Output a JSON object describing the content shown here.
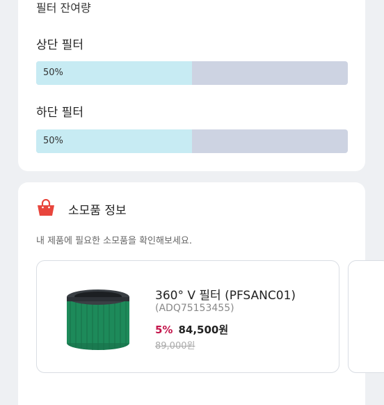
{
  "filter_status": {
    "title": "필터 잔여량",
    "filters": [
      {
        "label": "상단 필터",
        "percent_text": "50%",
        "remaining_fraction": 0.5
      },
      {
        "label": "하단 필터",
        "percent_text": "50%",
        "remaining_fraction": 0.5
      }
    ]
  },
  "consumables": {
    "icon": "shopping-bag-icon",
    "title": "소모품 정보",
    "description": "내 제품에 필요한 소모품을 확인해보세요.",
    "products": [
      {
        "name": "360° V 필터 (PFSANC01)",
        "code": "(ADQ75153455)",
        "discount": "5%",
        "price": "84,500원",
        "original_price": "89,000원"
      }
    ]
  },
  "colors": {
    "bar_fill": "#c7ebf3",
    "bar_track": "#cdd3e2",
    "discount": "#c4154b",
    "bag_icon": "#e8453c",
    "filter_green": "#1d8a5a"
  }
}
